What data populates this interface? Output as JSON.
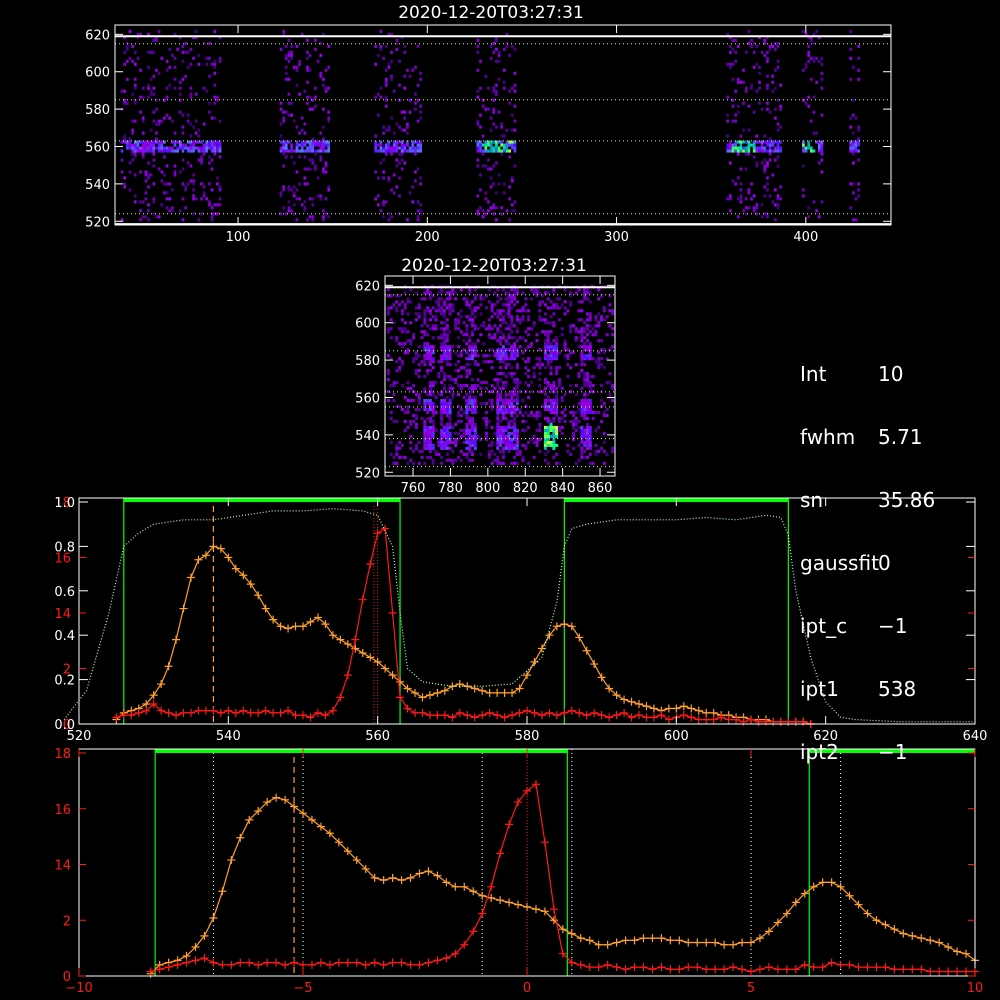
{
  "top_image": {
    "title": "2020-12-20T03:27:31",
    "xrange": [
      35,
      445
    ],
    "yrange": [
      518,
      625
    ],
    "xticks": [
      100,
      200,
      300,
      400
    ],
    "yticks": [
      520,
      540,
      560,
      580,
      600,
      620
    ],
    "hlines_white": [
      518.5,
      619
    ],
    "hlines_dotted": [
      524,
      563,
      585,
      615
    ],
    "bands": [
      [
        38,
        90
      ],
      [
        122,
        148
      ],
      [
        172,
        196
      ],
      [
        226,
        246
      ],
      [
        358,
        386
      ],
      [
        398,
        408
      ],
      [
        423,
        428
      ]
    ],
    "bright": [
      [
        228,
        245
      ],
      [
        360,
        372
      ],
      [
        398,
        406
      ]
    ]
  },
  "mid_image": {
    "title": "2020-12-20T03:27:31",
    "xrange": [
      745,
      868
    ],
    "yrange": [
      518,
      625
    ],
    "xticks": [
      760,
      780,
      800,
      820,
      840,
      860
    ],
    "yticks": [
      520,
      540,
      560,
      580,
      600,
      620
    ],
    "hlines_white": [
      619
    ],
    "hlines_dotted": [
      523,
      538,
      555,
      563,
      585,
      615
    ]
  },
  "info": [
    {
      "key": "Int",
      "value": "10"
    },
    {
      "key": "fwhm",
      "value": "5.71"
    },
    {
      "key": "sn",
      "value": "35.86"
    },
    {
      "key": "gaussfit",
      "value": "0"
    },
    {
      "key": "ipt_c",
      "value": "−1"
    },
    {
      "key": "ipt1",
      "value": "538"
    },
    {
      "key": "ipt2",
      "value": "−1"
    }
  ],
  "chart_data": [
    {
      "type": "line",
      "xrange": [
        520,
        640
      ],
      "xticks": [
        520,
        540,
        560,
        580,
        600,
        620,
        640
      ],
      "yrange_left": [
        0,
        1
      ],
      "yticks_left": [
        "0.0",
        "0.2",
        "0.4",
        "0.6",
        "0.8",
        "1.0"
      ],
      "yticks_red": [
        "0",
        "2",
        "14",
        "16",
        "18"
      ],
      "colors": {
        "orange": "#ffa030",
        "red": "#ff1a1a",
        "green": "#00ff00",
        "lightgreen": "#b8ffb8"
      },
      "bars_green": [
        [
          526,
          563
        ],
        [
          585,
          615
        ]
      ],
      "vlines_green": [
        526,
        563,
        585,
        615
      ],
      "vline_orange_dashed": 538,
      "vlines_red_dotted": [
        559.5,
        560
      ],
      "series": [
        {
          "color": "orange",
          "x": [
            525,
            526,
            527,
            528,
            529,
            530,
            531,
            532,
            533,
            534,
            535,
            536,
            537,
            538,
            539,
            540,
            541,
            542,
            543,
            544,
            545,
            546,
            547,
            548,
            549,
            550,
            551,
            552,
            553,
            554,
            555,
            556,
            557,
            558,
            559,
            560,
            561,
            562,
            563,
            564,
            565,
            566,
            567,
            568,
            569,
            570,
            571,
            572,
            573,
            574,
            575,
            576,
            577,
            578,
            579,
            580,
            581,
            582,
            583,
            584,
            585,
            586,
            587,
            588,
            589,
            590,
            591,
            592,
            593,
            594,
            595,
            596,
            597,
            598,
            599,
            600,
            601,
            602,
            603,
            604,
            605,
            606,
            607,
            608,
            609,
            610,
            611,
            612,
            613,
            614,
            615,
            616,
            617,
            618
          ],
          "y": [
            0.02,
            0.05,
            0.06,
            0.07,
            0.09,
            0.13,
            0.18,
            0.26,
            0.38,
            0.52,
            0.66,
            0.74,
            0.76,
            0.8,
            0.79,
            0.75,
            0.7,
            0.67,
            0.63,
            0.58,
            0.52,
            0.47,
            0.44,
            0.43,
            0.44,
            0.44,
            0.46,
            0.48,
            0.45,
            0.4,
            0.38,
            0.36,
            0.34,
            0.32,
            0.3,
            0.28,
            0.25,
            0.22,
            0.19,
            0.16,
            0.14,
            0.12,
            0.13,
            0.14,
            0.15,
            0.17,
            0.18,
            0.17,
            0.16,
            0.15,
            0.14,
            0.14,
            0.14,
            0.14,
            0.16,
            0.22,
            0.28,
            0.34,
            0.4,
            0.44,
            0.45,
            0.44,
            0.39,
            0.33,
            0.27,
            0.21,
            0.16,
            0.13,
            0.11,
            0.1,
            0.09,
            0.08,
            0.07,
            0.06,
            0.07,
            0.07,
            0.08,
            0.07,
            0.06,
            0.05,
            0.05,
            0.04,
            0.04,
            0.03,
            0.03,
            0.02,
            0.02,
            0.02,
            0.01,
            0.01,
            0.01,
            0.01,
            0.01,
            0.0
          ]
        },
        {
          "color": "red",
          "x": [
            525,
            526,
            527,
            528,
            529,
            530,
            531,
            532,
            533,
            534,
            535,
            536,
            537,
            538,
            539,
            540,
            541,
            542,
            543,
            544,
            545,
            546,
            547,
            548,
            549,
            550,
            551,
            552,
            553,
            554,
            555,
            556,
            557,
            558,
            559,
            560,
            561,
            562,
            563,
            564,
            565,
            566,
            567,
            568,
            569,
            570,
            571,
            572,
            573,
            574,
            575,
            576,
            577,
            578,
            579,
            580,
            581,
            582,
            583,
            584,
            585,
            586,
            587,
            588,
            589,
            590,
            591,
            592,
            593,
            594,
            595,
            596,
            597,
            598,
            599,
            600,
            601,
            602,
            603,
            604,
            605,
            606,
            607,
            608,
            609,
            610,
            611,
            612,
            613,
            614,
            615,
            616,
            617,
            618
          ],
          "y": [
            0.03,
            0.04,
            0.04,
            0.05,
            0.06,
            0.09,
            0.06,
            0.05,
            0.04,
            0.05,
            0.05,
            0.06,
            0.06,
            0.06,
            0.05,
            0.06,
            0.05,
            0.06,
            0.05,
            0.05,
            0.06,
            0.05,
            0.05,
            0.06,
            0.04,
            0.04,
            0.03,
            0.05,
            0.04,
            0.06,
            0.12,
            0.22,
            0.38,
            0.56,
            0.72,
            0.86,
            0.88,
            0.5,
            0.12,
            0.07,
            0.05,
            0.05,
            0.04,
            0.04,
            0.04,
            0.03,
            0.05,
            0.04,
            0.03,
            0.04,
            0.05,
            0.04,
            0.03,
            0.04,
            0.05,
            0.06,
            0.05,
            0.04,
            0.05,
            0.04,
            0.05,
            0.06,
            0.05,
            0.04,
            0.05,
            0.04,
            0.03,
            0.04,
            0.05,
            0.03,
            0.04,
            0.03,
            0.03,
            0.04,
            0.02,
            0.03,
            0.04,
            0.03,
            0.02,
            0.02,
            0.02,
            0.03,
            0.02,
            0.02,
            0.01,
            0.02,
            0.01,
            0.01,
            0.01,
            0.01,
            0.01,
            0.01,
            0.01,
            0.0
          ]
        },
        {
          "color": "lightgreen",
          "dotted": true,
          "x": [
            518,
            521,
            524,
            526,
            528,
            530,
            534,
            538,
            542,
            546,
            550,
            554,
            558,
            560,
            562,
            563,
            564,
            566,
            570,
            574,
            578,
            582,
            584,
            585,
            586,
            588,
            592,
            596,
            600,
            604,
            608,
            612,
            614,
            615,
            616,
            618,
            620,
            622,
            624,
            630,
            640
          ],
          "y": [
            0.02,
            0.15,
            0.5,
            0.8,
            0.86,
            0.9,
            0.92,
            0.92,
            0.94,
            0.96,
            0.96,
            0.97,
            0.96,
            0.94,
            0.8,
            0.5,
            0.25,
            0.19,
            0.17,
            0.17,
            0.18,
            0.3,
            0.55,
            0.8,
            0.88,
            0.9,
            0.92,
            0.92,
            0.92,
            0.93,
            0.92,
            0.94,
            0.93,
            0.85,
            0.6,
            0.3,
            0.1,
            0.03,
            0.02,
            0.01,
            0.01
          ]
        }
      ]
    },
    {
      "type": "line",
      "xrange": [
        -10,
        10
      ],
      "xticks": [
        -10,
        -5,
        0,
        5,
        10
      ],
      "yticks_red": [
        "0",
        "2",
        "14",
        "16",
        "18"
      ],
      "colors": {
        "orange": "#ffa030",
        "red": "#ff1a1a",
        "green": "#00ff00"
      },
      "bars_green": [
        [
          -8.3,
          0.9
        ],
        [
          6.3,
          10
        ]
      ],
      "vlines_green": [
        -8.3,
        0.9,
        6.3
      ],
      "vline_orange_dashed": -5.2,
      "vlines_white_dotted": [
        -7,
        -5,
        -1,
        1,
        5,
        7
      ],
      "vline_red_dotted": 0,
      "series": [
        {
          "color": "orange",
          "x": [
            -8.4,
            -8.2,
            -8.0,
            -7.8,
            -7.6,
            -7.4,
            -7.2,
            -7.0,
            -6.8,
            -6.6,
            -6.4,
            -6.2,
            -6.0,
            -5.8,
            -5.6,
            -5.4,
            -5.2,
            -5.0,
            -4.8,
            -4.6,
            -4.4,
            -4.2,
            -4.0,
            -3.8,
            -3.6,
            -3.4,
            -3.2,
            -3.0,
            -2.8,
            -2.6,
            -2.4,
            -2.2,
            -2.0,
            -1.8,
            -1.6,
            -1.4,
            -1.2,
            -1.0,
            -0.8,
            -0.6,
            -0.4,
            -0.2,
            0.0,
            0.2,
            0.4,
            0.6,
            0.8,
            1.0,
            1.2,
            1.4,
            1.6,
            1.8,
            2.0,
            2.2,
            2.4,
            2.6,
            2.8,
            3.0,
            3.2,
            3.4,
            3.6,
            3.8,
            4.0,
            4.2,
            4.4,
            4.6,
            4.8,
            5.0,
            5.2,
            5.4,
            5.6,
            5.8,
            6.0,
            6.2,
            6.4,
            6.6,
            6.8,
            7.0,
            7.2,
            7.4,
            7.6,
            7.8,
            8.0,
            8.2,
            8.4,
            8.6,
            8.8,
            9.0,
            9.2,
            9.4,
            9.6,
            9.8,
            10.0
          ],
          "y": [
            0.01,
            0.05,
            0.06,
            0.07,
            0.09,
            0.13,
            0.18,
            0.26,
            0.38,
            0.52,
            0.62,
            0.7,
            0.74,
            0.78,
            0.8,
            0.79,
            0.76,
            0.73,
            0.7,
            0.67,
            0.64,
            0.6,
            0.56,
            0.52,
            0.48,
            0.44,
            0.43,
            0.44,
            0.43,
            0.44,
            0.46,
            0.47,
            0.45,
            0.42,
            0.4,
            0.4,
            0.38,
            0.36,
            0.35,
            0.34,
            0.33,
            0.32,
            0.31,
            0.3,
            0.29,
            0.25,
            0.21,
            0.19,
            0.17,
            0.16,
            0.14,
            0.14,
            0.15,
            0.16,
            0.16,
            0.17,
            0.17,
            0.17,
            0.16,
            0.16,
            0.15,
            0.15,
            0.15,
            0.15,
            0.14,
            0.14,
            0.15,
            0.15,
            0.17,
            0.2,
            0.24,
            0.28,
            0.33,
            0.37,
            0.4,
            0.42,
            0.42,
            0.4,
            0.36,
            0.32,
            0.28,
            0.25,
            0.23,
            0.21,
            0.19,
            0.18,
            0.17,
            0.16,
            0.15,
            0.13,
            0.11,
            0.1,
            0.07
          ]
        },
        {
          "color": "red",
          "x": [
            -8.4,
            -8.2,
            -8.0,
            -7.8,
            -7.6,
            -7.4,
            -7.2,
            -7.0,
            -6.8,
            -6.6,
            -6.4,
            -6.2,
            -6.0,
            -5.8,
            -5.6,
            -5.4,
            -5.2,
            -5.0,
            -4.8,
            -4.6,
            -4.4,
            -4.2,
            -4.0,
            -3.8,
            -3.6,
            -3.4,
            -3.2,
            -3.0,
            -2.8,
            -2.6,
            -2.4,
            -2.2,
            -2.0,
            -1.8,
            -1.6,
            -1.4,
            -1.2,
            -1.0,
            -0.8,
            -0.6,
            -0.4,
            -0.2,
            0.0,
            0.2,
            0.4,
            0.6,
            0.8,
            1.0,
            1.2,
            1.4,
            1.6,
            1.8,
            2.0,
            2.2,
            2.4,
            2.6,
            2.8,
            3.0,
            3.2,
            3.4,
            3.6,
            3.8,
            4.0,
            4.2,
            4.4,
            4.6,
            4.8,
            5.0,
            5.2,
            5.4,
            5.6,
            5.8,
            6.0,
            6.2,
            6.4,
            6.6,
            6.8,
            7.0,
            7.2,
            7.4,
            7.6,
            7.8,
            8.0,
            8.2,
            8.4,
            8.6,
            8.8,
            9.0,
            9.2,
            9.4,
            9.6,
            9.8,
            10.0
          ],
          "y": [
            0.02,
            0.03,
            0.04,
            0.05,
            0.06,
            0.07,
            0.08,
            0.06,
            0.05,
            0.05,
            0.06,
            0.06,
            0.05,
            0.06,
            0.06,
            0.05,
            0.06,
            0.05,
            0.05,
            0.06,
            0.05,
            0.06,
            0.06,
            0.06,
            0.05,
            0.06,
            0.05,
            0.06,
            0.06,
            0.05,
            0.05,
            0.06,
            0.07,
            0.08,
            0.1,
            0.14,
            0.2,
            0.28,
            0.4,
            0.55,
            0.68,
            0.78,
            0.83,
            0.86,
            0.6,
            0.3,
            0.1,
            0.06,
            0.05,
            0.04,
            0.04,
            0.05,
            0.04,
            0.03,
            0.04,
            0.04,
            0.03,
            0.04,
            0.03,
            0.03,
            0.04,
            0.04,
            0.03,
            0.03,
            0.03,
            0.04,
            0.03,
            0.02,
            0.03,
            0.04,
            0.03,
            0.03,
            0.03,
            0.05,
            0.04,
            0.04,
            0.06,
            0.05,
            0.05,
            0.04,
            0.04,
            0.04,
            0.04,
            0.03,
            0.03,
            0.03,
            0.03,
            0.02,
            0.02,
            0.02,
            0.02,
            0.02,
            0.02
          ]
        }
      ]
    }
  ]
}
